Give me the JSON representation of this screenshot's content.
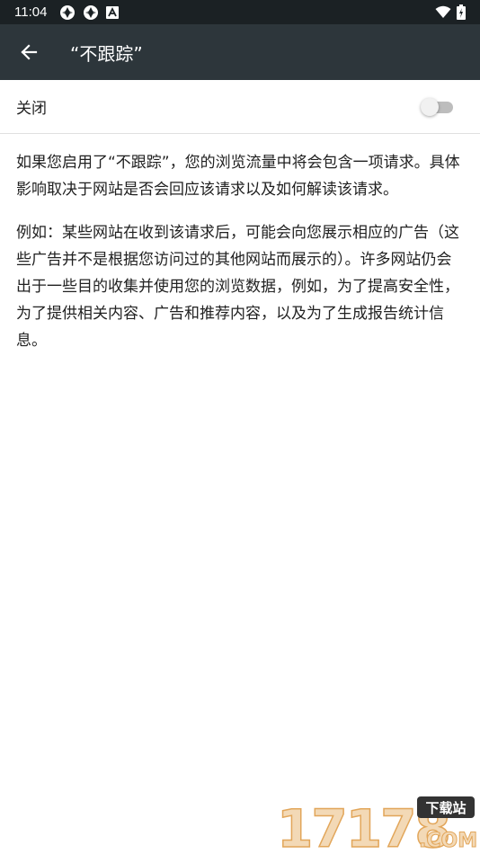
{
  "status_bar": {
    "time": "11:04"
  },
  "toolbar": {
    "title": "“不跟踪”"
  },
  "setting": {
    "label": "关闭",
    "enabled": false
  },
  "content": {
    "paragraphs": [
      "如果您启用了“不跟踪”，您的浏览流量中将会包含一项请求。具体影响取决于网站是否会回应该请求以及如何解读该请求。",
      "例如：某些网站在收到该请求后，可能会向您展示相应的广告（这些广告并不是根据您访问过的其他网站而展示的）。许多网站仍会出于一些目的收集并使用您的浏览数据，例如，为了提高安全性，为了提供相关内容、广告和推荐内容，以及为了生成报告统计信息。"
    ]
  },
  "watermark": {
    "number": "17178",
    "tag": "下载站",
    "domain": ".COM"
  },
  "colors": {
    "status_bar": "#1b2124",
    "toolbar": "#2d363b",
    "toggle_track": "#bdbdbd",
    "toggle_thumb": "#f1f1f1"
  }
}
